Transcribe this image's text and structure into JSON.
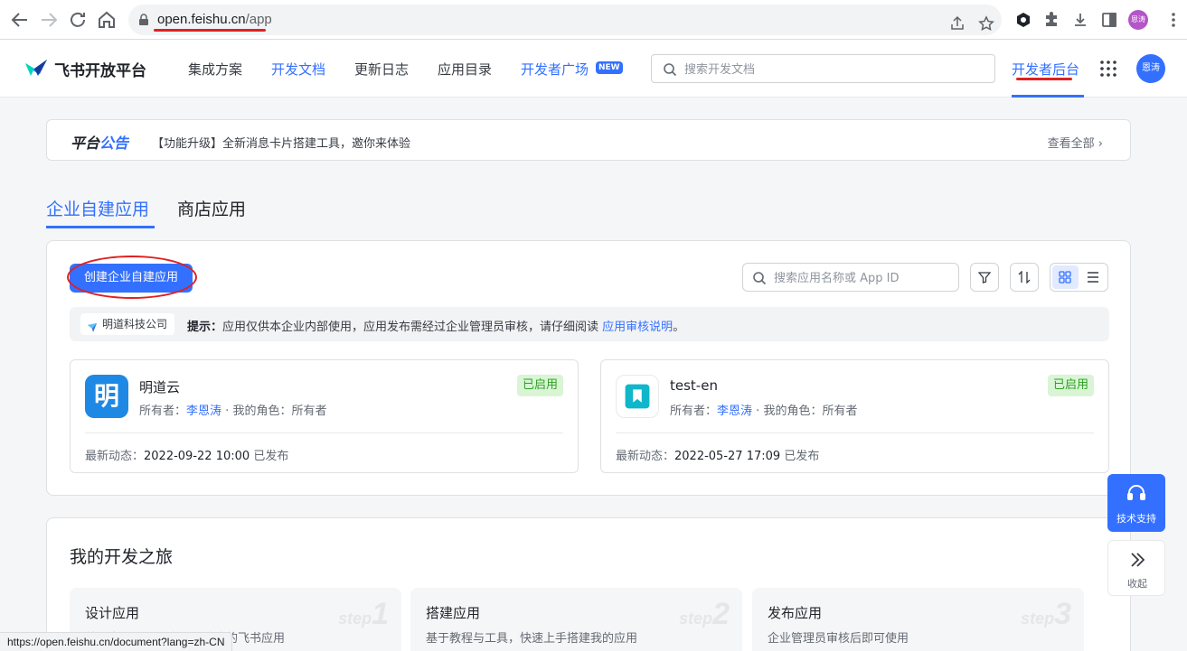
{
  "browser": {
    "url_host": "open.feishu.cn",
    "url_path": "/app",
    "profile_initials": "恩涛",
    "status_url": "https://open.feishu.cn/document?lang=zh-CN"
  },
  "header": {
    "logo_text": "飞书开放平台",
    "nav": [
      {
        "label": "集成方案"
      },
      {
        "label": "开发文档"
      },
      {
        "label": "更新日志"
      },
      {
        "label": "应用目录"
      },
      {
        "label": "开发者广场"
      }
    ],
    "new_badge": "NEW",
    "search_placeholder": "搜索开发文档",
    "dev_console": "开发者后台",
    "avatar": "恩涛"
  },
  "announcement": {
    "title_a": "平台",
    "title_b": "公告",
    "text": "【功能升级】全新消息卡片搭建工具，邀你来体验",
    "more": "查看全部"
  },
  "tabs": [
    {
      "label": "企业自建应用",
      "active": true
    },
    {
      "label": "商店应用",
      "active": false
    }
  ],
  "apps": {
    "create_button": "创建企业自建应用",
    "search_placeholder": "搜索应用名称或 App ID",
    "tenant": "明道科技公司",
    "tip_label": "提示：",
    "tip_text": "应用仅供本企业内部使用，应用发布需经过企业管理员审核，请仔细阅读",
    "tip_link": "应用审核说明",
    "tip_end": "。",
    "cards": [
      {
        "name": "明道云",
        "owner_label": "所有者：",
        "owner": "李恩涛",
        "sep": "·",
        "role_label": "我的角色：",
        "role": "所有者",
        "status": "已启用",
        "activity_label": "最新动态：",
        "activity_time": "2022-09-22 10:00",
        "activity_status": "已发布",
        "icon": "mingdao-app-icon",
        "icon_char": "明",
        "icon_color": "#1e88e5"
      },
      {
        "name": "test-en",
        "owner_label": "所有者：",
        "owner": "李恩涛",
        "sep": "·",
        "role_label": "我的角色：",
        "role": "所有者",
        "status": "已启用",
        "activity_label": "最新动态：",
        "activity_time": "2022-05-27 17:09",
        "activity_status": "已发布",
        "icon": "bookmark-app-icon",
        "icon_color": "#10b6c9"
      }
    ]
  },
  "journey": {
    "title": "我的开发之旅",
    "steps": [
      {
        "title": "设计应用",
        "desc": "基于企业场景需求，设计我的飞书应用",
        "num_word": "step",
        "num": "1"
      },
      {
        "title": "搭建应用",
        "desc": "基于教程与工具，快速上手搭建我的应用",
        "num_word": "step",
        "num": "2"
      },
      {
        "title": "发布应用",
        "desc": "企业管理员审核后即可使用",
        "num_word": "step",
        "num": "3"
      }
    ]
  },
  "float": {
    "support": "技术支持",
    "collapse": "收起"
  },
  "colors": {
    "accent": "#3370ff",
    "annotation_red": "#e02020",
    "status_green": "#2ea121"
  }
}
